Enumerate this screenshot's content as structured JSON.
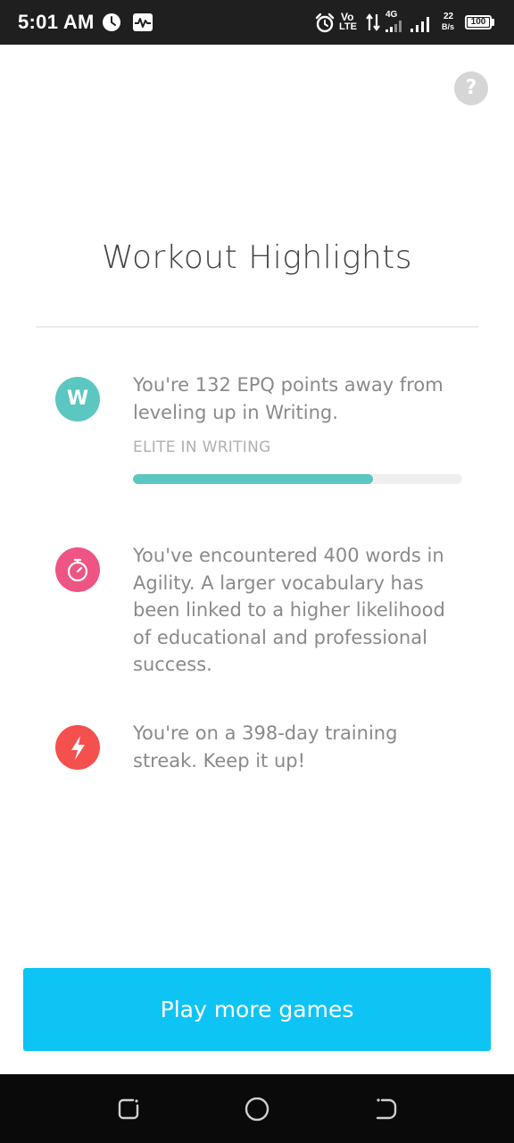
{
  "status_bar": {
    "time": "5:01 AM",
    "network_type": "4G",
    "volte_top": "Vo",
    "volte_bottom": "LTE",
    "speed_value": "22",
    "speed_unit": "B/s",
    "battery": "100",
    "icons": [
      "clock-icon",
      "activity-icon",
      "alarm-icon",
      "volte-icon",
      "data-arrows-icon",
      "signal-icon",
      "signal-icon-2",
      "battery-icon"
    ]
  },
  "header": {
    "help_label": "?",
    "title": "Workout Highlights"
  },
  "highlights": [
    {
      "icon": "writing-w-icon",
      "icon_letter": "W",
      "icon_color": "#5bc7c0",
      "text": "You're 132 EPQ points away from leveling up in Writing.",
      "level_label": "ELITE IN WRITING",
      "progress": 0.73
    },
    {
      "icon": "stopwatch-icon",
      "icon_color": "#ee5584",
      "text": "You've encountered 400 words in Agility. A larger vocabulary has been linked to a higher likelihood of educational and professional success."
    },
    {
      "icon": "lightning-icon",
      "icon_color": "#f4504d",
      "text": "You're on a 398-day training streak. Keep it up!"
    }
  ],
  "cta": {
    "label": "Play more games",
    "color": "#0ec4f5"
  },
  "nav_bar": {
    "icons": [
      "recent-apps-icon",
      "home-icon",
      "back-icon"
    ]
  }
}
